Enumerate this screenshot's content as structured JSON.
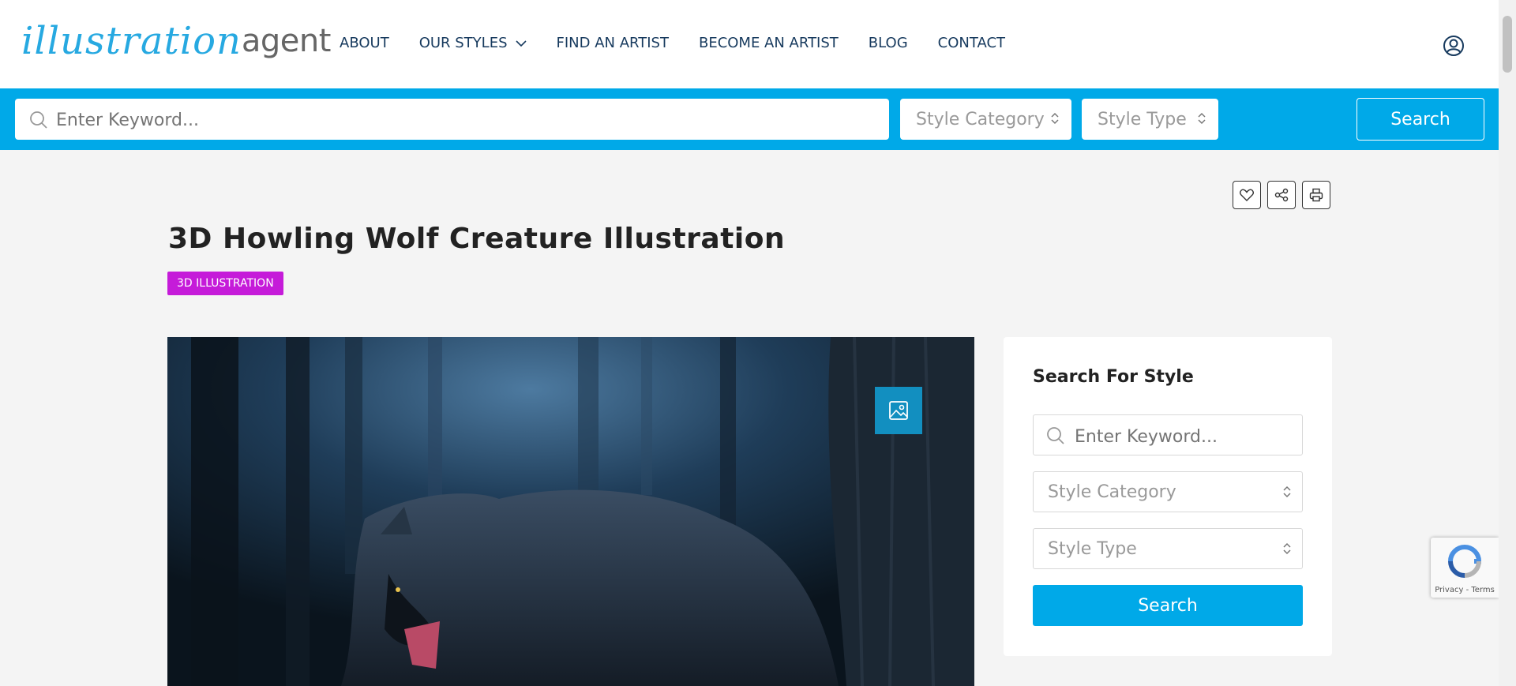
{
  "logo": {
    "part1": "illustration",
    "part2": "agent"
  },
  "nav": {
    "items": [
      "ABOUT",
      "OUR STYLES",
      "FIND AN ARTIST",
      "BECOME AN ARTIST",
      "BLOG",
      "CONTACT"
    ]
  },
  "search_bar": {
    "keyword_placeholder": "Enter Keyword...",
    "category_label": "Style Category",
    "type_label": "Style Type",
    "button_label": "Search"
  },
  "page": {
    "title": "3D Howling Wolf Creature Illustration",
    "badge": "3D ILLUSTRATION"
  },
  "sidebar": {
    "heading": "Search For Style",
    "keyword_placeholder": "Enter Keyword...",
    "category_label": "Style Category",
    "type_label": "Style Type",
    "button_label": "Search"
  },
  "recaptcha": {
    "text": "Privacy - Terms"
  },
  "colors": {
    "accent": "#00a9e8",
    "badge": "#c51bd9",
    "nav_text": "#173a5e",
    "logo_blue": "#27a9e1"
  }
}
